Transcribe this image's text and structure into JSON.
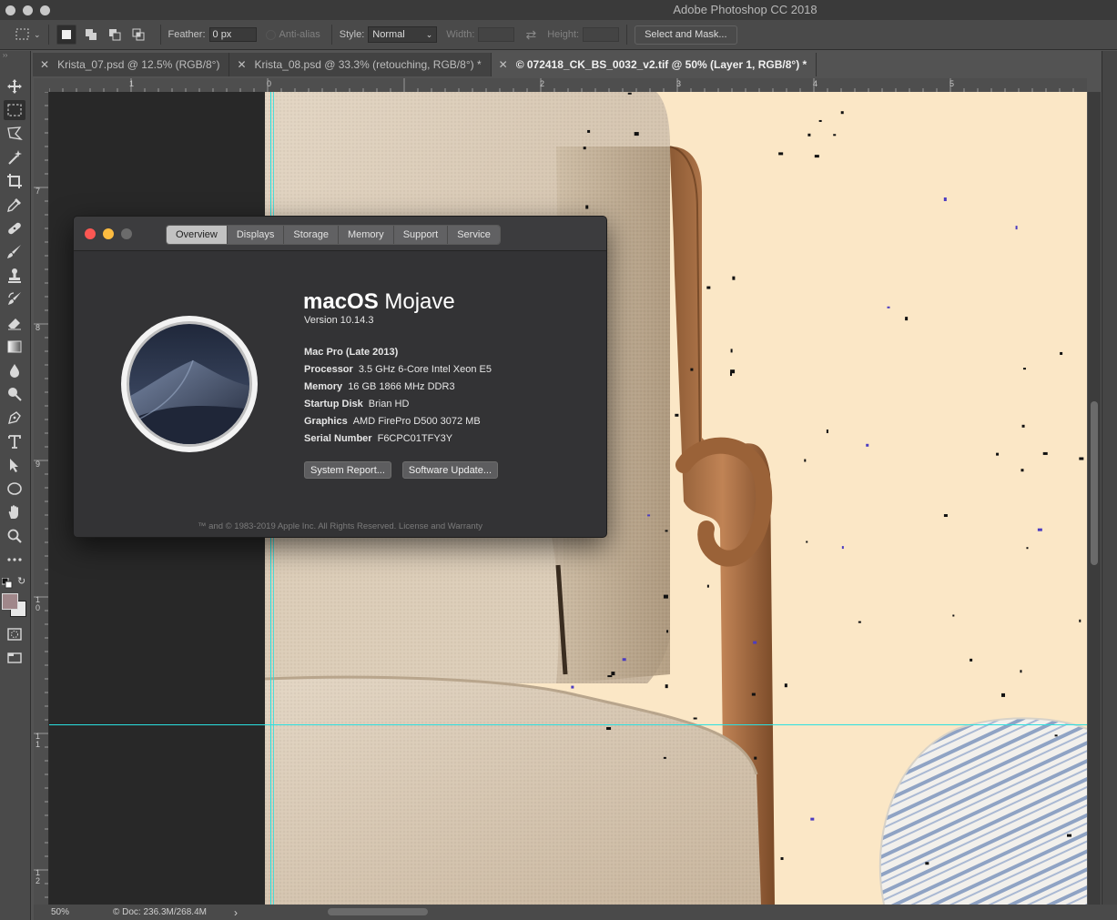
{
  "app": {
    "title": "Adobe Photoshop CC 2018"
  },
  "options_bar": {
    "feather_label": "Feather:",
    "feather_value": "0 px",
    "antialias_label": "Anti-alias",
    "style_label": "Style:",
    "style_value": "Normal",
    "width_label": "Width:",
    "height_label": "Height:",
    "select_mask_label": "Select and Mask..."
  },
  "tabs": [
    {
      "label": "Krista_07.psd @ 12.5% (RGB/8°)",
      "active": false
    },
    {
      "label": "Krista_08.psd @ 33.3% (retouching, RGB/8°) *",
      "active": false
    },
    {
      "label": "© 072418_CK_BS_0032_v2.tif @ 50% (Layer 1, RGB/8°) *",
      "active": true
    }
  ],
  "rulers": {
    "horizontal": [
      "1",
      "0",
      "2",
      "3",
      "4",
      "5"
    ],
    "vertical": [
      "7",
      "8",
      "9",
      "1\n0",
      "1\n1",
      "1\n2"
    ]
  },
  "status": {
    "zoom": "50%",
    "doc": "© Doc: 236.3M/268.4M",
    "arrow": "›"
  },
  "about_mac": {
    "tabs": [
      "Overview",
      "Displays",
      "Storage",
      "Memory",
      "Support",
      "Service"
    ],
    "active_tab": "Overview",
    "os_name_bold": "macOS",
    "os_name_light": " Mojave",
    "version": "Version 10.14.3",
    "model": "Mac Pro (Late 2013)",
    "specs": [
      {
        "key": "Processor",
        "value": "3.5 GHz 6-Core Intel Xeon E5"
      },
      {
        "key": "Memory",
        "value": "16 GB 1866 MHz DDR3"
      },
      {
        "key": "Startup Disk",
        "value": "Brian HD"
      },
      {
        "key": "Graphics",
        "value": "AMD FirePro D500 3072 MB"
      },
      {
        "key": "Serial Number",
        "value": "F6CPC01TFY3Y"
      }
    ],
    "system_report_label": "System Report...",
    "software_update_label": "Software Update...",
    "footer": "™ and © 1983-2019 Apple Inc. All Rights Reserved. License and Warranty"
  },
  "colors": {
    "close": "#fc5753",
    "minimize": "#fdbc40",
    "zoom_inactive": "#6b6b6b",
    "guide": "#2ae0e0",
    "backdrop": "#fbe7c6"
  }
}
